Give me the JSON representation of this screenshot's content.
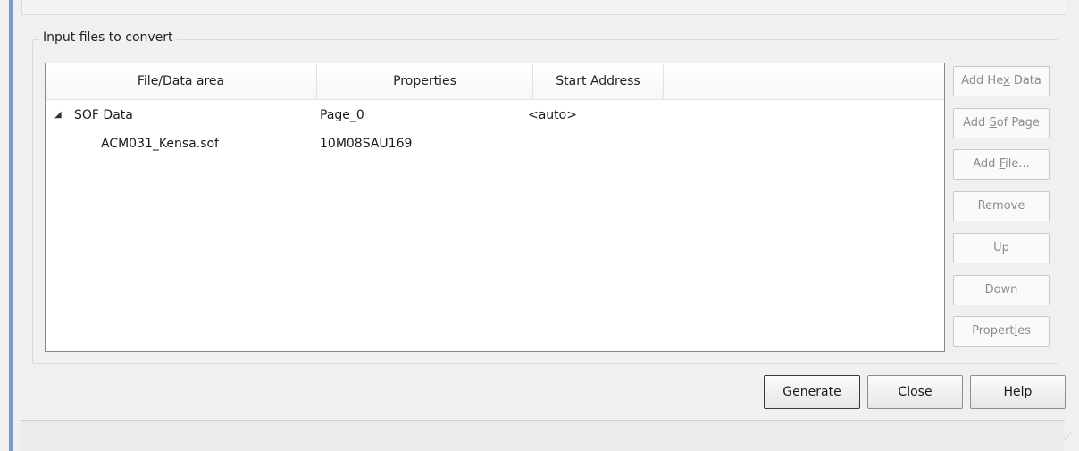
{
  "group": {
    "title": "Input files to convert"
  },
  "table": {
    "columns": [
      "File/Data area",
      "Properties",
      "Start Address",
      ""
    ],
    "rows": [
      {
        "expander": "◢",
        "name": "SOF Data",
        "properties": "Page_0",
        "start_address": "<auto>"
      },
      {
        "expander": "",
        "name": "ACM031_Kensa.sof",
        "properties": "10M08SAU169",
        "start_address": ""
      }
    ]
  },
  "side_buttons": {
    "add_hex_data": {
      "pre": "Add He",
      "key": "x",
      "post": " Data"
    },
    "add_sof_page": {
      "pre": "Add ",
      "key": "S",
      "post": "of Page"
    },
    "add_file": {
      "pre": "Add ",
      "key": "F",
      "post": "ile..."
    },
    "remove": {
      "label": "Remove"
    },
    "up": {
      "label": "Up"
    },
    "down": {
      "label": "Down"
    },
    "properties": {
      "pre": "Propert",
      "key": "i",
      "post": "es"
    }
  },
  "footer": {
    "generate": {
      "pre": "",
      "key": "G",
      "post": "enerate"
    },
    "close": {
      "label": "Close"
    },
    "help": {
      "label": "Help"
    }
  },
  "icons": {
    "resize_grip": "⋰"
  },
  "colors": {
    "accent": "#7e9bc6",
    "disabled_text": "#8c8c8c"
  }
}
